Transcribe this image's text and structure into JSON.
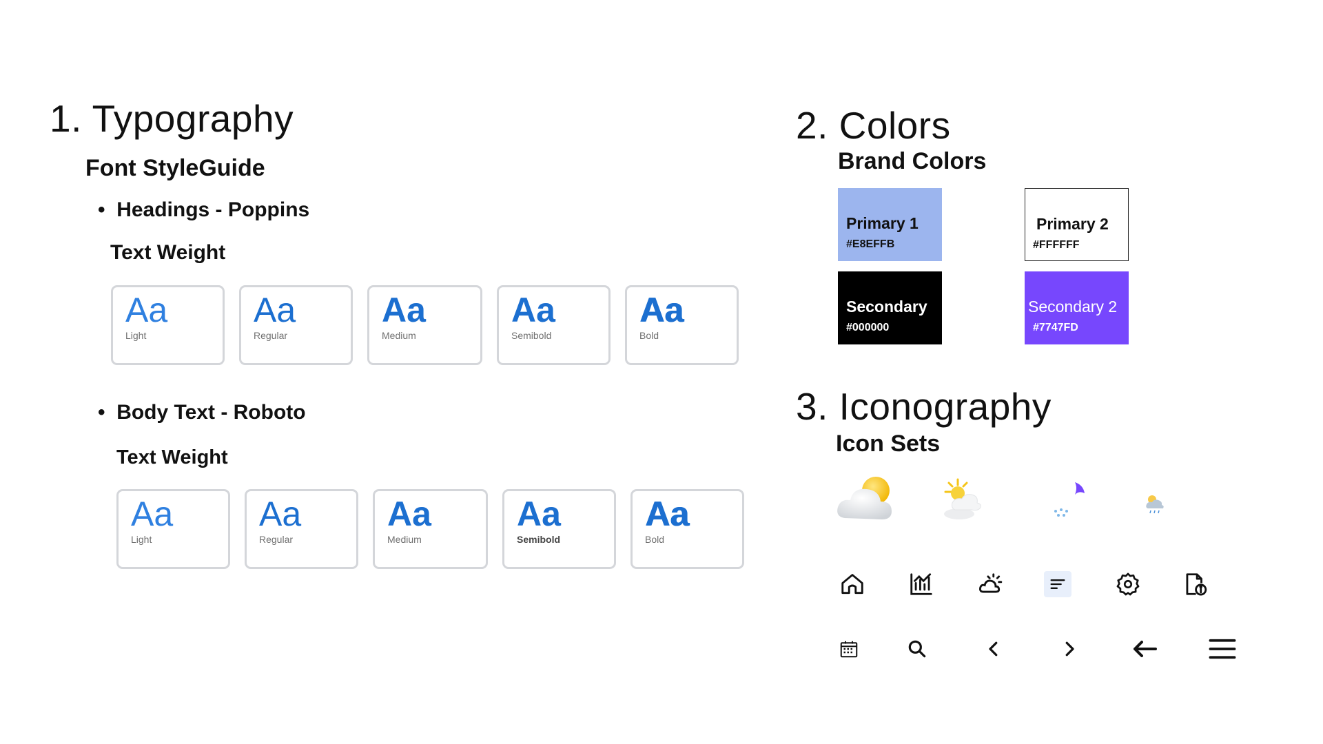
{
  "typography": {
    "title": "1. Typography",
    "subtitle": "Font StyleGuide",
    "headings": {
      "bullet": "Headings - Poppins",
      "weight_title": "Text Weight",
      "sample_text": "Aa",
      "weights": [
        "Light",
        "Regular",
        "Medium",
        "Semibold",
        "Bold"
      ]
    },
    "body": {
      "bullet": "Body Text - Roboto",
      "weight_title": "Text Weight",
      "sample_text": "Aa",
      "weights": [
        "Light",
        "Regular",
        "Medium",
        "Semibold",
        "Bold"
      ]
    },
    "sample_color": "#1C6FD0"
  },
  "colors": {
    "title": "2. Colors",
    "subtitle": "Brand Colors",
    "swatches": [
      {
        "name": "Primary 1",
        "hex": "#E8EFFB",
        "fill": "#9CB5EE",
        "text_color": "#111111"
      },
      {
        "name": "Primary 2",
        "hex": "#FFFFFF",
        "fill": "#FFFFFF",
        "text_color": "#111111"
      },
      {
        "name": "Secondary",
        "hex": "#000000",
        "fill": "#000000",
        "text_color": "#FFFFFF"
      },
      {
        "name": "Secondary 2",
        "hex": "#7747FD",
        "fill": "#7747FD",
        "text_color": "#FFFFFF"
      }
    ]
  },
  "iconography": {
    "title": "3. Iconography",
    "subtitle": "Icon Sets",
    "weather_icons": [
      "partly-cloudy-icon",
      "sun-behind-cloud-icon",
      "night-rain-icon",
      "rain-cloud-icon"
    ],
    "row1_icons": [
      "home-icon",
      "bar-chart-icon",
      "weather-icon",
      "sort-lines-icon",
      "gear-icon",
      "document-info-icon"
    ],
    "row2_icons": [
      "calendar-icon",
      "search-icon",
      "chevron-left-icon",
      "chevron-right-icon",
      "arrow-left-icon",
      "menu-icon"
    ]
  }
}
